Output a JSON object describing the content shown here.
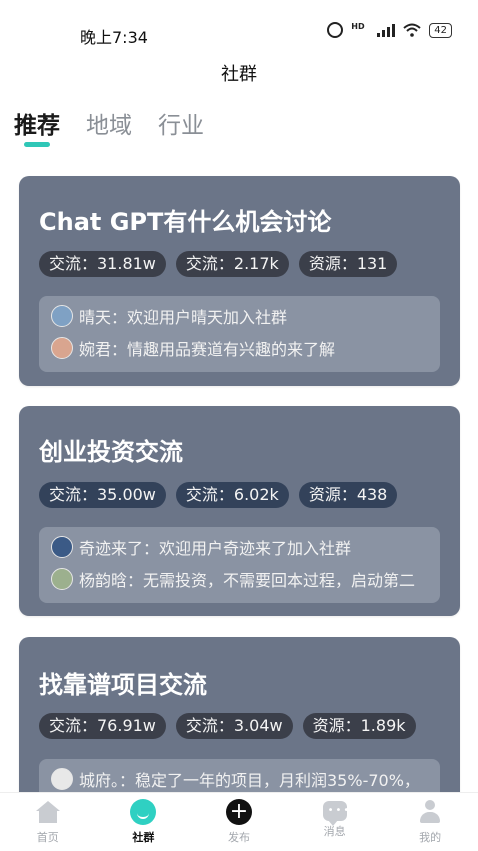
{
  "status_bar": {
    "time": "晚上7:34",
    "battery": "42"
  },
  "header": {
    "title": "社群"
  },
  "tabs": [
    {
      "label": "推荐"
    },
    {
      "label": "地域"
    },
    {
      "label": "行业"
    }
  ],
  "cards": [
    {
      "title": "Chat GPT有什么机会讨论",
      "chips": [
        "交流：31.81w",
        "交流：2.17k",
        "资源：131"
      ],
      "messages": [
        {
          "text": "晴天：欢迎用户晴天加入社群",
          "avatar_color": "#7fa1c4"
        },
        {
          "text": "婉君：情趣用品赛道有兴趣的来了解",
          "avatar_color": "#d9a58f"
        }
      ]
    },
    {
      "title": "创业投资交流",
      "chips": [
        "交流：35.00w",
        "交流：6.02k",
        "资源：438"
      ],
      "messages": [
        {
          "text": "奇迹来了：欢迎用户奇迹来了加入社群",
          "avatar_color": "#3b5a86"
        },
        {
          "text": "杨韵晗：无需投资，不需要回本过程，启动第二",
          "avatar_color": "#9cb08e"
        }
      ]
    },
    {
      "title": "找靠谱项目交流",
      "chips": [
        "交流：76.91w",
        "交流：3.04w",
        "资源：1.89k"
      ],
      "messages": [
        {
          "text": "城府。：稳定了一年的项目，月利润35%-70%，",
          "avatar_color": "#e8e8e8"
        }
      ]
    }
  ],
  "bottom_nav": [
    {
      "label": "首页",
      "icon": "home-icon"
    },
    {
      "label": "社群",
      "icon": "community-icon"
    },
    {
      "label": "发布",
      "icon": "publish-plus-icon"
    },
    {
      "label": "消息",
      "icon": "message-icon"
    },
    {
      "label": "我的",
      "icon": "profile-icon"
    }
  ]
}
